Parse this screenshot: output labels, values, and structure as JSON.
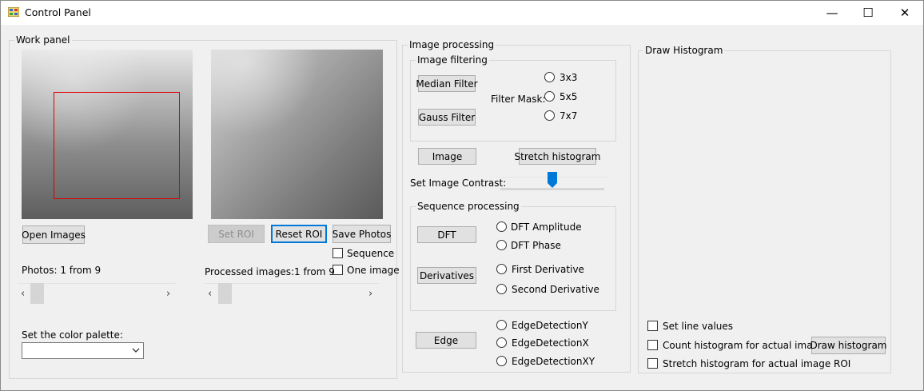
{
  "window": {
    "title": "Control Panel",
    "minimize_glyph": "—",
    "maximize_glyph": "☐",
    "close_glyph": "✕"
  },
  "work_panel": {
    "legend": "Work panel",
    "open_images_label": "Open Images",
    "set_roi_label": "Set ROI",
    "reset_roi_label": "Reset ROI",
    "save_photos_label": "Save Photos",
    "sequence_label": "Sequence",
    "one_image_label": "One image",
    "photos_counter": "Photos: 1 from 9",
    "processed_counter": "Processed images:1 from 9",
    "color_palette_label": "Set the color palette:",
    "color_palette_value": ""
  },
  "image_processing": {
    "legend": "Image processing",
    "filtering_legend": "Image filtering",
    "median_filter_label": "Median Filter",
    "gauss_filter_label": "Gauss Filter",
    "filter_mask_label": "Filter Mask:",
    "mask_options": [
      "3x3",
      "5x5",
      "7x7"
    ],
    "image_label": "Image",
    "stretch_histogram_label": "Stretch histogram",
    "contrast_label": "Set Image Contrast:",
    "contrast_level_fraction": 0.5,
    "sequence_legend": "Sequence processing",
    "dft_label": "DFT",
    "dft_amplitude_label": "DFT Amplitude",
    "dft_phase_label": "DFT Phase",
    "derivatives_label": "Derivatives",
    "first_derivative_label": "First Derivative",
    "second_derivative_label": "Second Derivative",
    "edge_label": "Edge",
    "edge_y_label": "EdgeDetectionY",
    "edge_x_label": "EdgeDetectionX",
    "edge_xy_label": "EdgeDetectionXY"
  },
  "histogram": {
    "legend": "Draw Histogram",
    "set_line_values_label": "Set line values",
    "count_roi_label": "Count histogram for actual image ROI",
    "stretch_roi_label": "Stretch histogram for actual image ROI",
    "draw_histogram_label": "Draw histogram"
  },
  "colors": {
    "accent": "#0078d7",
    "roi": "#e00000"
  }
}
